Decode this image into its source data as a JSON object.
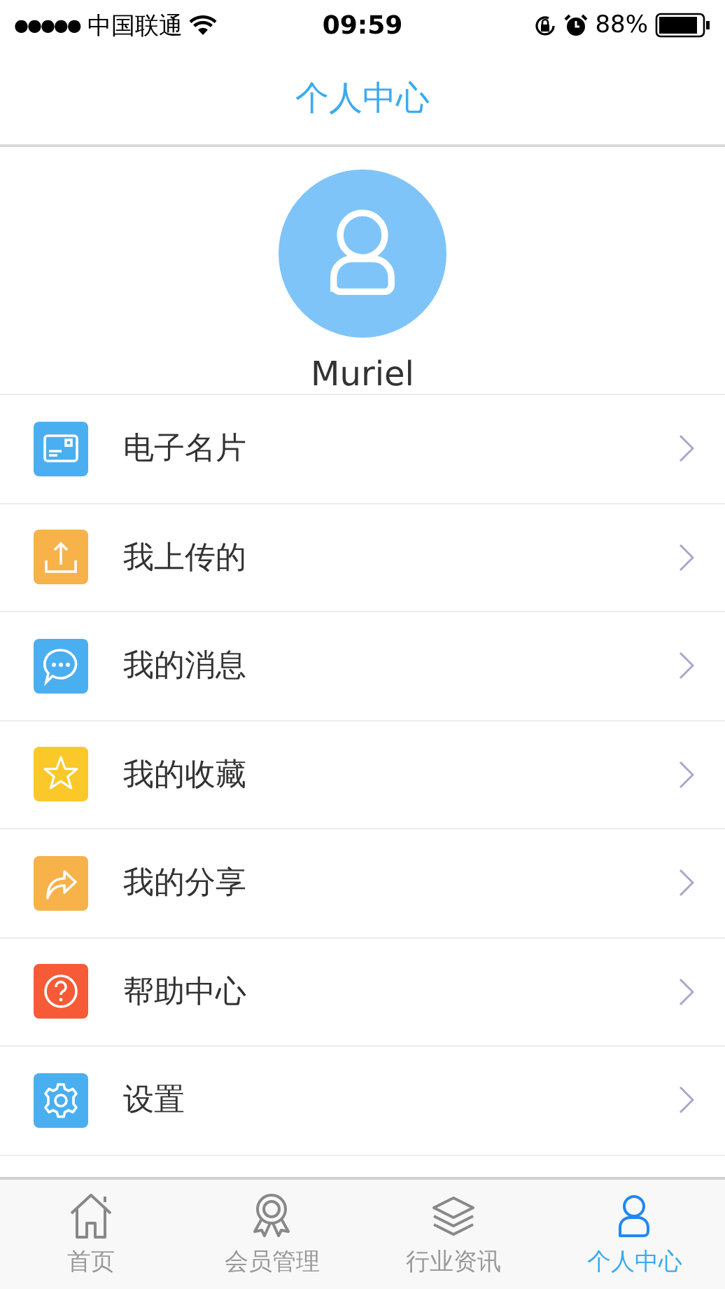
{
  "status_bar": {
    "signal": "●●●●●",
    "carrier": "中国联通",
    "time": "09:59",
    "battery": "88%"
  },
  "nav": {
    "title": "个人中心"
  },
  "profile": {
    "name": "Muriel"
  },
  "menu": [
    {
      "label": "电子名片",
      "kind": "card",
      "color": "#4aaff0"
    },
    {
      "label": "我上传的",
      "kind": "upload",
      "color": "#f7b24a"
    },
    {
      "label": "我的消息",
      "kind": "message",
      "color": "#4aaff0"
    },
    {
      "label": "我的收藏",
      "kind": "star",
      "color": "#fbc82a"
    },
    {
      "label": "我的分享",
      "kind": "share",
      "color": "#f7b24a"
    },
    {
      "label": "帮助中心",
      "kind": "help",
      "color": "#f65a36"
    },
    {
      "label": "设置",
      "kind": "settings",
      "color": "#4aaff0"
    }
  ],
  "tabs": [
    {
      "label": "首页",
      "kind": "home",
      "selected": false
    },
    {
      "label": "会员管理",
      "kind": "award",
      "selected": false
    },
    {
      "label": "行业资讯",
      "kind": "layers",
      "selected": false
    },
    {
      "label": "个人中心",
      "kind": "person",
      "selected": true
    }
  ]
}
